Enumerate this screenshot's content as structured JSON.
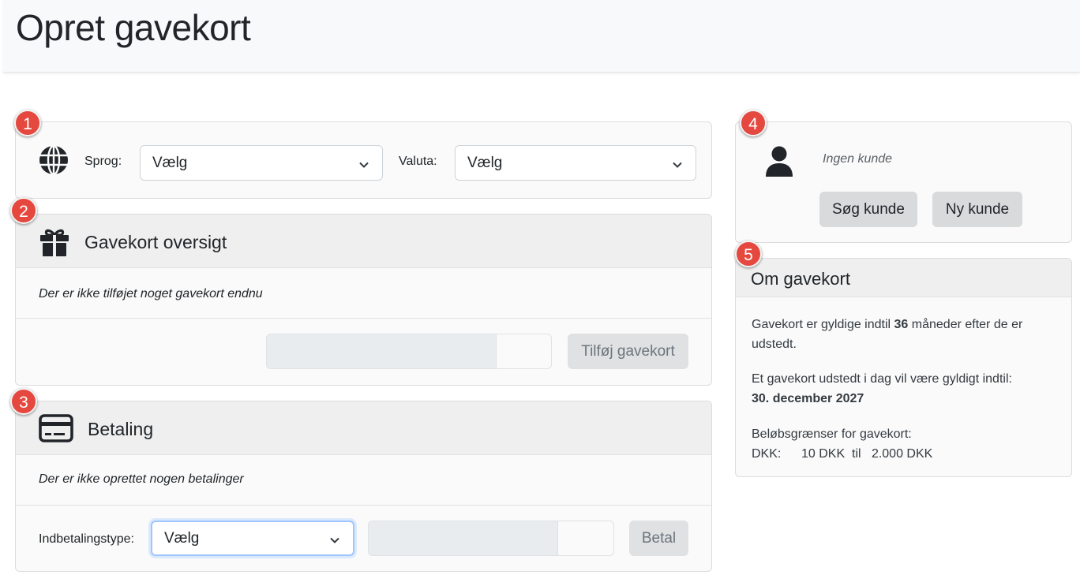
{
  "page": {
    "title": "Opret gavekort"
  },
  "badges": [
    "1",
    "2",
    "3",
    "4",
    "5"
  ],
  "settings": {
    "language_label": "Sprog:",
    "language_value": "Vælg",
    "currency_label": "Valuta:",
    "currency_value": "Vælg"
  },
  "giftcards": {
    "title": "Gavekort oversigt",
    "empty_text": "Der er ikke tilføjet noget gavekort endnu",
    "add_button": "Tilføj gavekort"
  },
  "payment": {
    "title": "Betaling",
    "empty_text": "Der er ikke oprettet nogen betalinger",
    "type_label": "Indbetalingstype:",
    "type_value": "Vælg",
    "pay_button": "Betal"
  },
  "customer": {
    "status": "Ingen kunde",
    "search_button": "Søg kunde",
    "new_button": "Ny kunde"
  },
  "about": {
    "title": "Om gavekort",
    "validity_prefix": "Gavekort er gyldige indtil ",
    "validity_months": "36",
    "validity_suffix": " måneder efter de er udstedt.",
    "issued_today": "Et gavekort udstedt i dag vil være gyldigt indtil:",
    "valid_until_date": "30. december 2027",
    "limits_title": "Beløbsgrænser for gavekort:",
    "limits_currency": "DKK:",
    "limits_min": "10 DKK",
    "limits_to": "til",
    "limits_max": "2.000 DKK"
  },
  "icons": {
    "language": "globe-icon",
    "giftcards": "gift-icon",
    "payment": "credit-card-icon",
    "customer": "person-icon",
    "dropdown": "chevron-down-icon"
  }
}
